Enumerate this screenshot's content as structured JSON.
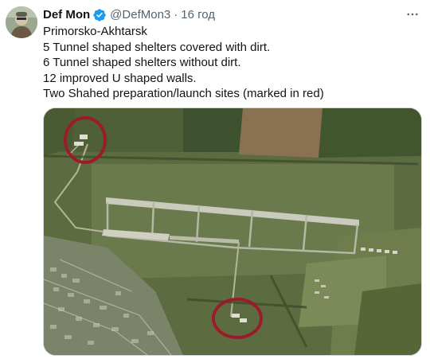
{
  "author": {
    "name": "Def Mon",
    "handle": "@DefMon3",
    "time": "16 год"
  },
  "tweet": {
    "lines": [
      "Primorsko-Akhtarsk",
      "5 Tunnel shaped shelters covered with dirt.",
      "6 Tunnel shaped shelters without dirt.",
      "12 improved U shaped walls.",
      "Two Shahed preparation/launch sites (marked in red)"
    ]
  },
  "media": {
    "marker_color": "#9b1b2a"
  },
  "icons": {
    "verified": "verified-badge-icon",
    "more": "more-options-icon"
  }
}
